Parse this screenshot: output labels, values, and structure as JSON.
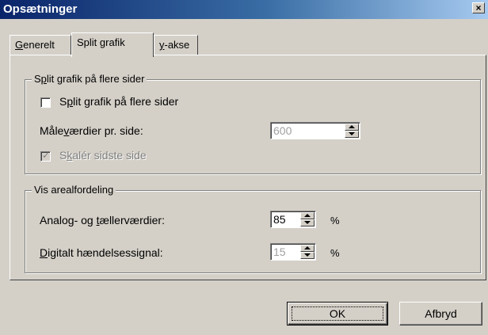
{
  "window": {
    "title": "Opsætninger",
    "close_glyph": "×"
  },
  "tabs": [
    {
      "label_underlined": "G",
      "label_rest": "enerelt"
    },
    {
      "label": "Split grafik"
    },
    {
      "label_underlined": "y",
      "label_rest": "-akse"
    }
  ],
  "group_split": {
    "legend_pre": "S",
    "legend_u": "p",
    "legend_rest": "lit grafik på flere sider",
    "checkbox_label_pre": "S",
    "checkbox_label_u": "p",
    "checkbox_label_rest": "lit grafik på flere sider",
    "checkbox_checked": false,
    "measure_label_pre": "Måle",
    "measure_label_u": "v",
    "measure_label_rest": "ærdier pr. side:",
    "measure_value": "600",
    "scale_label_pre": "S",
    "scale_label_u": "k",
    "scale_label_rest": "alér sidste side",
    "scale_checked": true
  },
  "group_area": {
    "legend": "Vis arealfordeling",
    "analog_label_pre": "Analog- og ",
    "analog_label_u": "t",
    "analog_label_rest": "ællerværdier:",
    "analog_value": "85",
    "analog_unit": "%",
    "digital_label_u": "D",
    "digital_label_rest": "igitalt hændelsessignal:",
    "digital_value": "15",
    "digital_unit": "%"
  },
  "buttons": {
    "ok": "OK",
    "cancel": "Afbryd"
  }
}
